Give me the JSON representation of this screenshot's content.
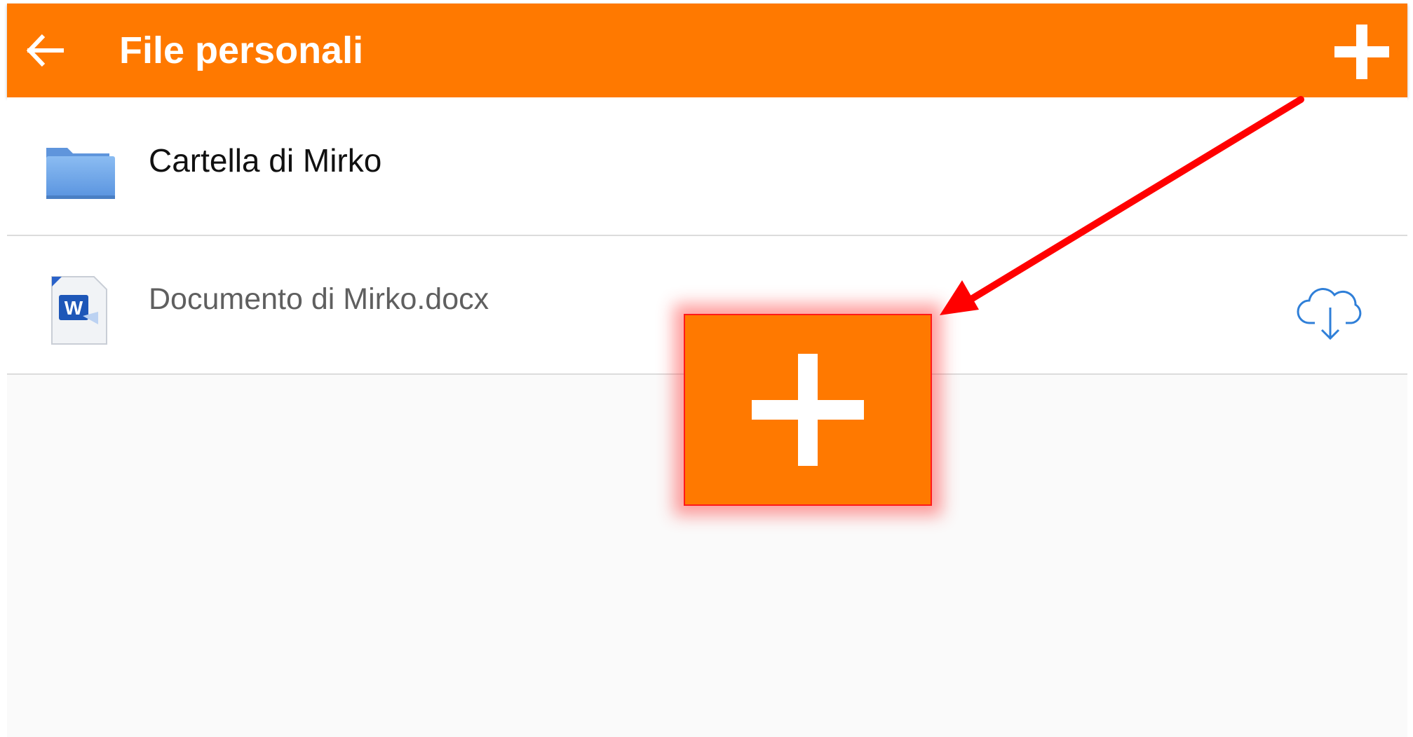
{
  "header": {
    "title": "File personali",
    "back_icon": "arrow-left-icon",
    "add_icon": "plus-icon"
  },
  "items": [
    {
      "type": "folder",
      "label": "Cartella di Mirko",
      "icon": "folder-icon"
    },
    {
      "type": "file",
      "label": "Documento di Mirko.docx",
      "icon": "word-document-icon",
      "action_icon": "cloud-download-icon"
    }
  ],
  "overlay": {
    "icon": "plus-icon",
    "arrow_color": "#ff0000"
  },
  "colors": {
    "accent": "#ff7900",
    "folder": "#6ea6ea",
    "download_icon": "#2f7fd8",
    "highlight_border": "#ff1a1a"
  }
}
